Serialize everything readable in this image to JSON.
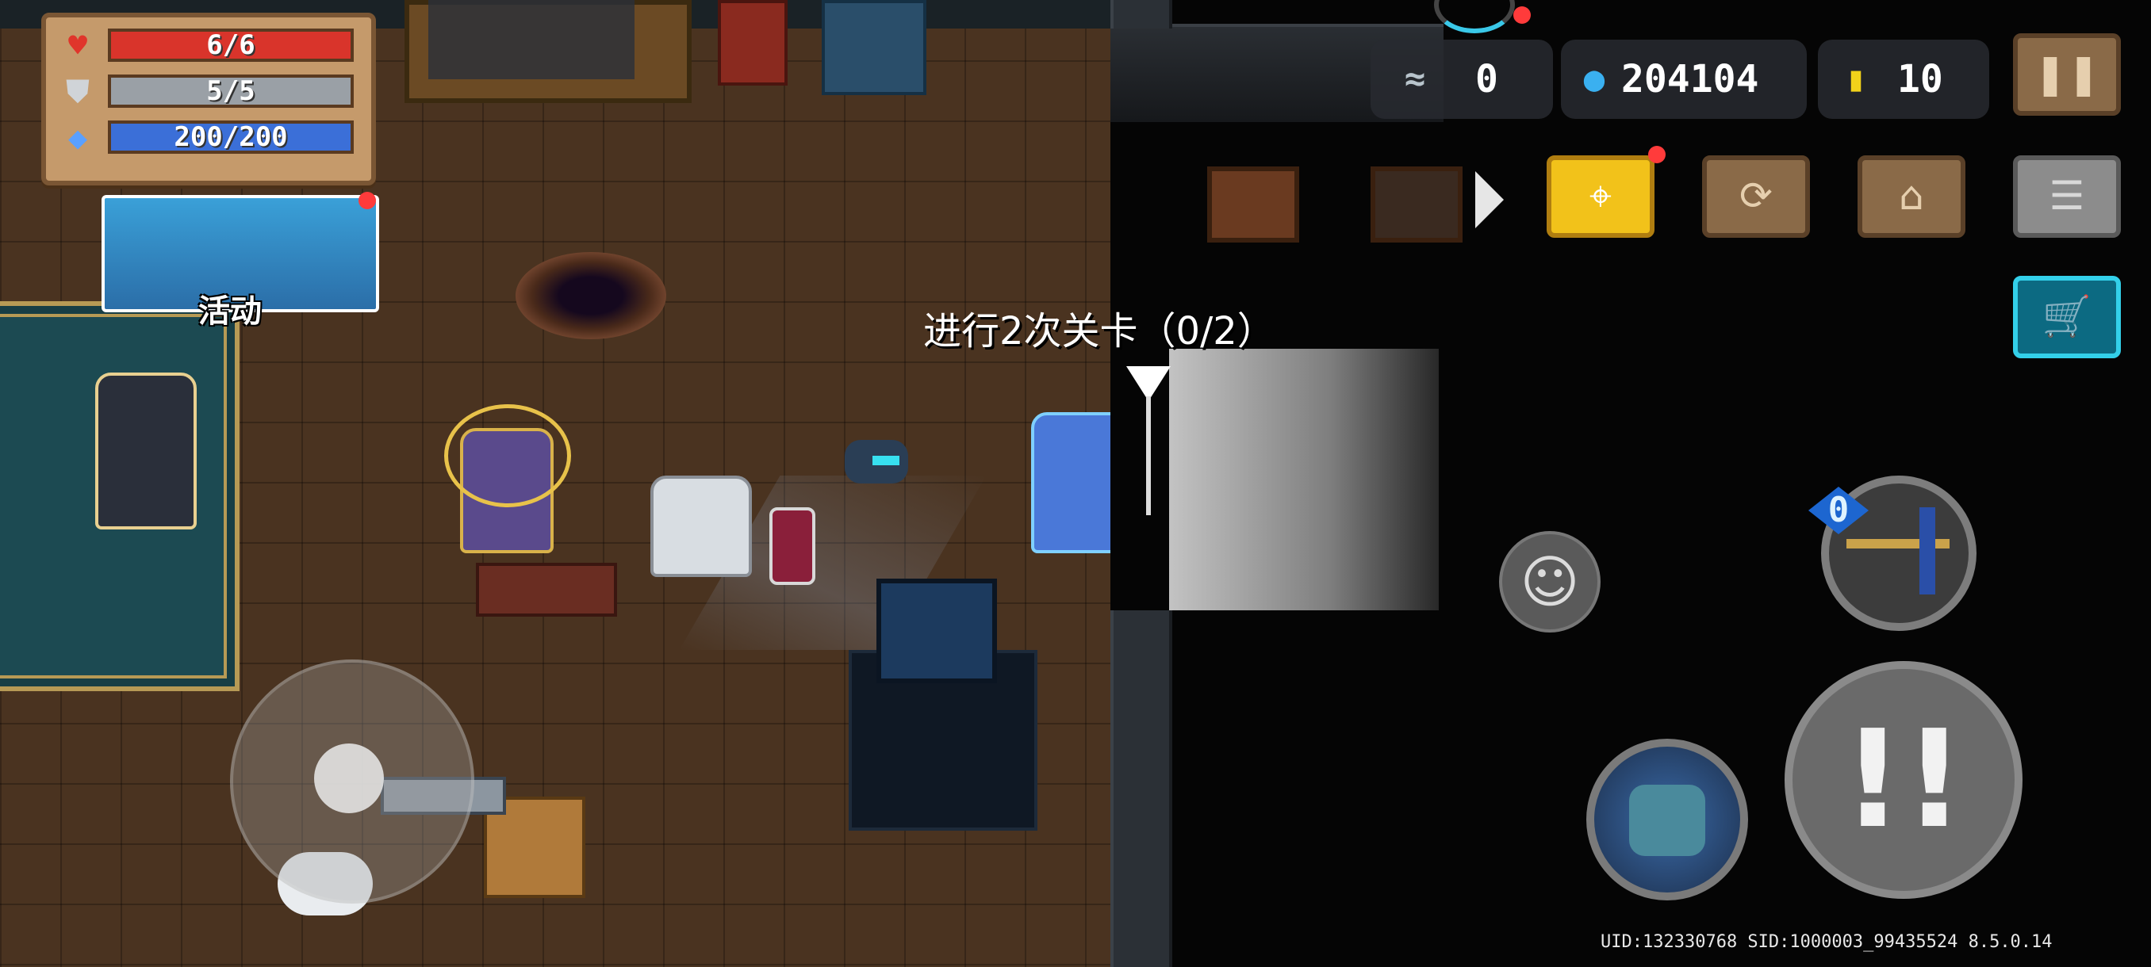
{
  "stats": {
    "hp": "6/6",
    "armor": "5/5",
    "energy": "200/200",
    "hp_fill": 1.0,
    "armor_fill": 1.0,
    "energy_fill": 1.0,
    "hp_color": "#d9342b",
    "armor_color": "#9aa0a6",
    "energy_color": "#3b6fd8"
  },
  "event": {
    "label": "活动"
  },
  "currency": {
    "fish": "0",
    "gems": "204104",
    "gold": "10"
  },
  "quest": {
    "text": "进行2次关卡（0/2）"
  },
  "weapon": {
    "ammo": "0"
  },
  "footer": {
    "uid": "UID:132330768 SID:1000003_99435524 8.5.0.14"
  },
  "icons": {
    "heart": "♥",
    "shield": "⛊",
    "diamond": "◆",
    "fish": "≈",
    "gem": "●",
    "coin": "▮",
    "pause": "❚❚",
    "location": "⌖",
    "swap": "⟳",
    "stairs": "⌂",
    "profile": "☰",
    "cart": "🛒",
    "emote": "☺",
    "attack": "!!"
  }
}
